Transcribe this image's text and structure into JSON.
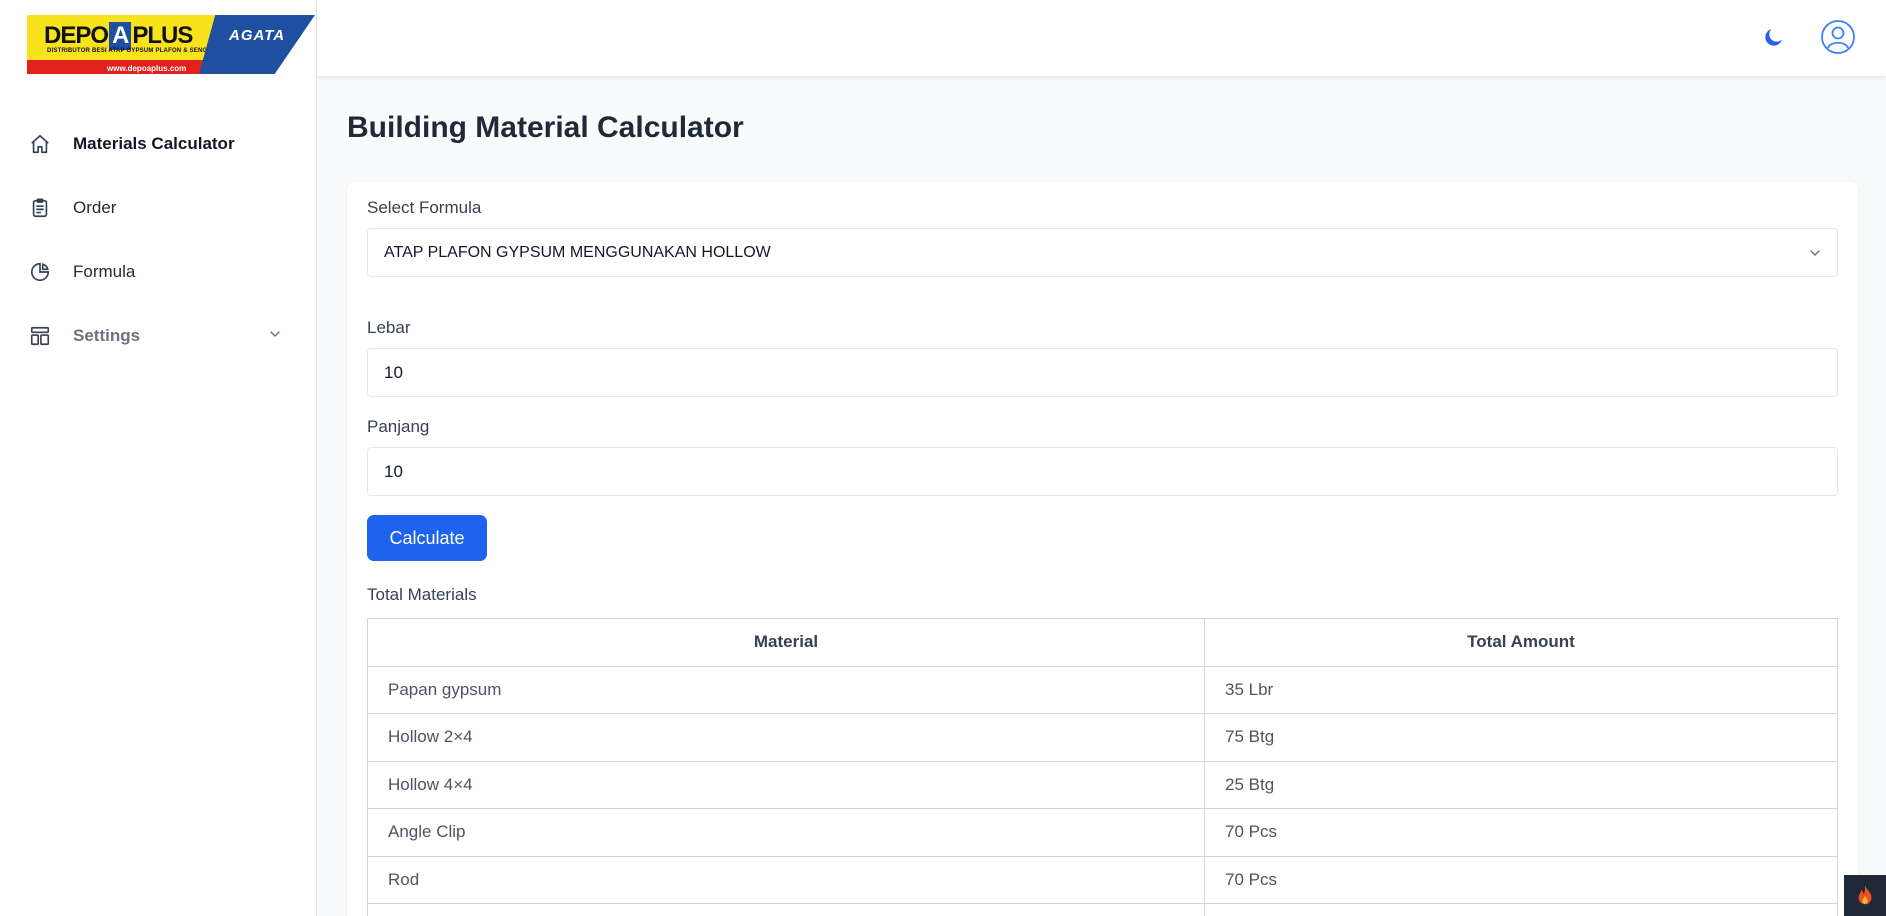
{
  "logo": {
    "brand_left": "DEPO",
    "brand_a": "A",
    "brand_right": "PLUS",
    "tagline": "DISTRIBUTOR BESI ATAP GYPSUM PLAFON & SENG",
    "url": "www.depoaplus.com",
    "partner": "AGATA"
  },
  "sidebar": {
    "items": [
      {
        "label": "Materials Calculator",
        "icon": "home-icon"
      },
      {
        "label": "Order",
        "icon": "clipboard-icon"
      },
      {
        "label": "Formula",
        "icon": "pie-chart-icon"
      },
      {
        "label": "Settings",
        "icon": "layout-icon"
      }
    ]
  },
  "main": {
    "title": "Building Material Calculator",
    "formula_label": "Select Formula",
    "formula_value": "ATAP PLAFON GYPSUM MENGGUNAKAN HOLLOW",
    "lebar_label": "Lebar",
    "lebar_value": "10",
    "panjang_label": "Panjang",
    "panjang_value": "10",
    "calculate_label": "Calculate",
    "total_label": "Total Materials",
    "table": {
      "headers": [
        "Material",
        "Total Amount"
      ],
      "rows": [
        [
          "Papan gypsum",
          "35 Lbr"
        ],
        [
          "Hollow 2×4",
          "75 Btg"
        ],
        [
          "Hollow 4×4",
          "25 Btg"
        ],
        [
          "Angle Clip",
          "70 Pcs"
        ],
        [
          "Rod",
          "70 Pcs"
        ]
      ]
    }
  },
  "colors": {
    "primary": "#1d63ed",
    "logo_yellow": "#f7e21b",
    "logo_red": "#e1211c",
    "logo_blue": "#1e4fa1"
  }
}
